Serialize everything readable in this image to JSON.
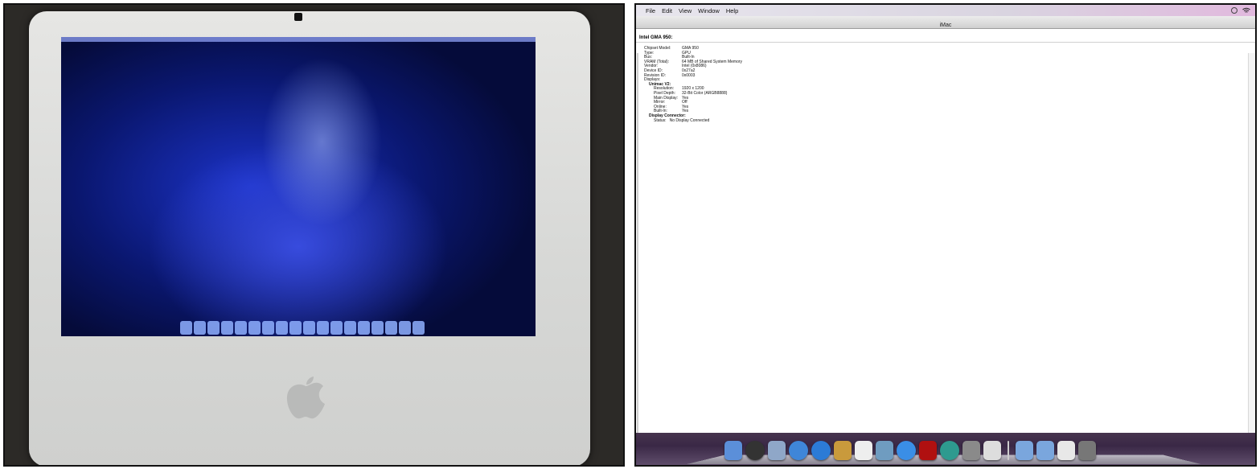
{
  "menubar": {
    "items": [
      "File",
      "Edit",
      "View",
      "Window",
      "Help"
    ]
  },
  "window": {
    "title": "iMac"
  },
  "section": {
    "title": "Intel GMA 950:"
  },
  "properties": [
    {
      "key": "Chipset Model:",
      "value": "GMA 950"
    },
    {
      "key": "Type:",
      "value": "GPU"
    },
    {
      "key": "Bus:",
      "value": "Built-In"
    },
    {
      "key": "VRAM (Total):",
      "value": "64 MB of Shared System Memory"
    },
    {
      "key": "Vendor:",
      "value": "Intel (0x8086)"
    },
    {
      "key": "Device ID:",
      "value": "0x27a2"
    },
    {
      "key": "Revision ID:",
      "value": "0x0003"
    }
  ],
  "displays_label": "Displays:",
  "unimac": {
    "title": "Unimac V2:",
    "props": [
      {
        "key": "Resolution:",
        "value": "1920 x 1200"
      },
      {
        "key": "Pixel Depth:",
        "value": "32-Bit Color (ARGB8888)"
      },
      {
        "key": "Main Display:",
        "value": "Yes"
      },
      {
        "key": "Mirror:",
        "value": "Off"
      },
      {
        "key": "Online:",
        "value": "Yes"
      },
      {
        "key": "Built-In:",
        "value": "Yes"
      }
    ]
  },
  "connector": {
    "title": "Display Connector:",
    "status_key": "Status:",
    "status_value": "No Display Connected"
  },
  "dock_icons": [
    {
      "name": "finder-icon",
      "color": "#5b8fd9"
    },
    {
      "name": "dashboard-icon",
      "color": "#333333"
    },
    {
      "name": "mail-icon",
      "color": "#8fa7c8"
    },
    {
      "name": "safari-icon",
      "color": "#3f86d8"
    },
    {
      "name": "ichat-icon",
      "color": "#2c7bd6"
    },
    {
      "name": "address-book-icon",
      "color": "#c99a3c"
    },
    {
      "name": "ical-icon",
      "color": "#eeeeee"
    },
    {
      "name": "iphoto-icon",
      "color": "#6f9cc0"
    },
    {
      "name": "itunes-icon",
      "color": "#3a8ee6"
    },
    {
      "name": "photo-booth-icon",
      "color": "#b01010"
    },
    {
      "name": "time-machine-icon",
      "color": "#2e9a8f"
    },
    {
      "name": "system-preferences-icon",
      "color": "#8a8a8a"
    },
    {
      "name": "xcode-icon",
      "color": "#dddddd"
    },
    {
      "name": "applications-folder-icon",
      "color": "#7aa6dd"
    },
    {
      "name": "documents-folder-icon",
      "color": "#7aa6dd"
    },
    {
      "name": "downloads-stack-icon",
      "color": "#e8e8e8"
    },
    {
      "name": "trash-icon",
      "color": "#777777"
    }
  ]
}
